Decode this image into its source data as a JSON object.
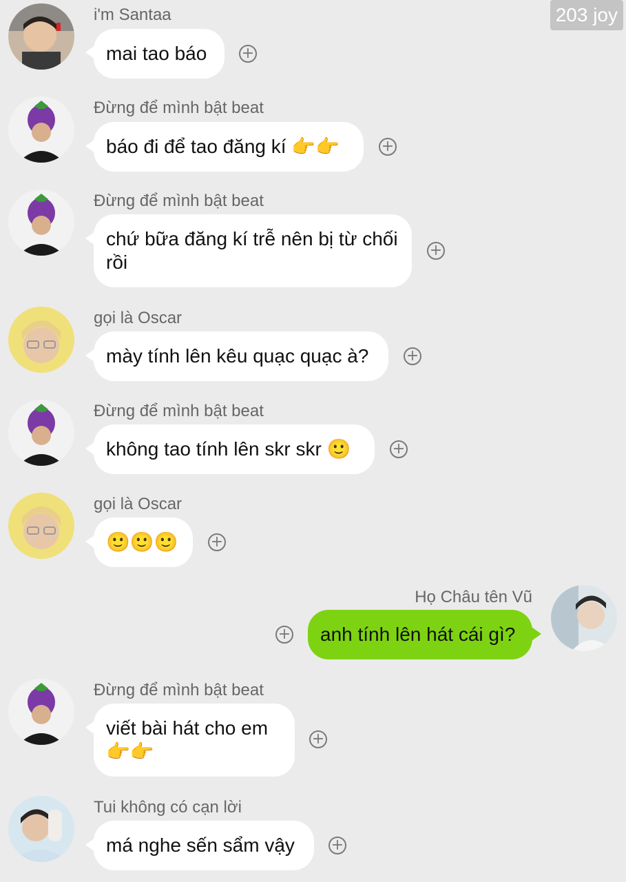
{
  "watermark": "203 joy",
  "react_glyph": "+",
  "messages": [
    {
      "sender": "i'm Santaa",
      "text": "mai tao báo",
      "avatar_icon": "santaa-avatar-icon"
    },
    {
      "sender": "Đừng để mình bật beat",
      "text": "báo đi để tao đăng kí 👉👉",
      "avatar_icon": "eggplant-hat-avatar-icon"
    },
    {
      "sender": "Đừng để mình bật beat",
      "text": "chứ bữa đăng kí trễ nên bị từ chối rồi",
      "avatar_icon": "eggplant-hat-avatar-icon"
    },
    {
      "sender": "gọi là Oscar",
      "text": "mày tính lên kêu quạc quạc à?",
      "avatar_icon": "oscar-avatar-icon"
    },
    {
      "sender": "Đừng để mình bật beat",
      "text": "không tao tính lên skr skr 🙂",
      "avatar_icon": "eggplant-hat-avatar-icon"
    },
    {
      "sender": "gọi là Oscar",
      "text": "🙂🙂🙂",
      "avatar_icon": "oscar-avatar-icon"
    },
    {
      "sender": "Họ Châu tên Vũ",
      "text": "anh tính lên hát cái gì?",
      "avatar_icon": "chau-vu-avatar-icon",
      "outgoing": true
    },
    {
      "sender": "Đừng để mình bật beat",
      "text": "viết bài hát cho em 👉👉",
      "avatar_icon": "eggplant-hat-avatar-icon"
    },
    {
      "sender": "Tui không có cạn lời",
      "text": "má nghe sến sẩm vậy",
      "avatar_icon": "can-loi-avatar-icon"
    }
  ],
  "colors": {
    "background": "#ebebeb",
    "incoming_bubble": "#ffffff",
    "outgoing_bubble": "#7dd312",
    "sender_name": "#666666"
  }
}
